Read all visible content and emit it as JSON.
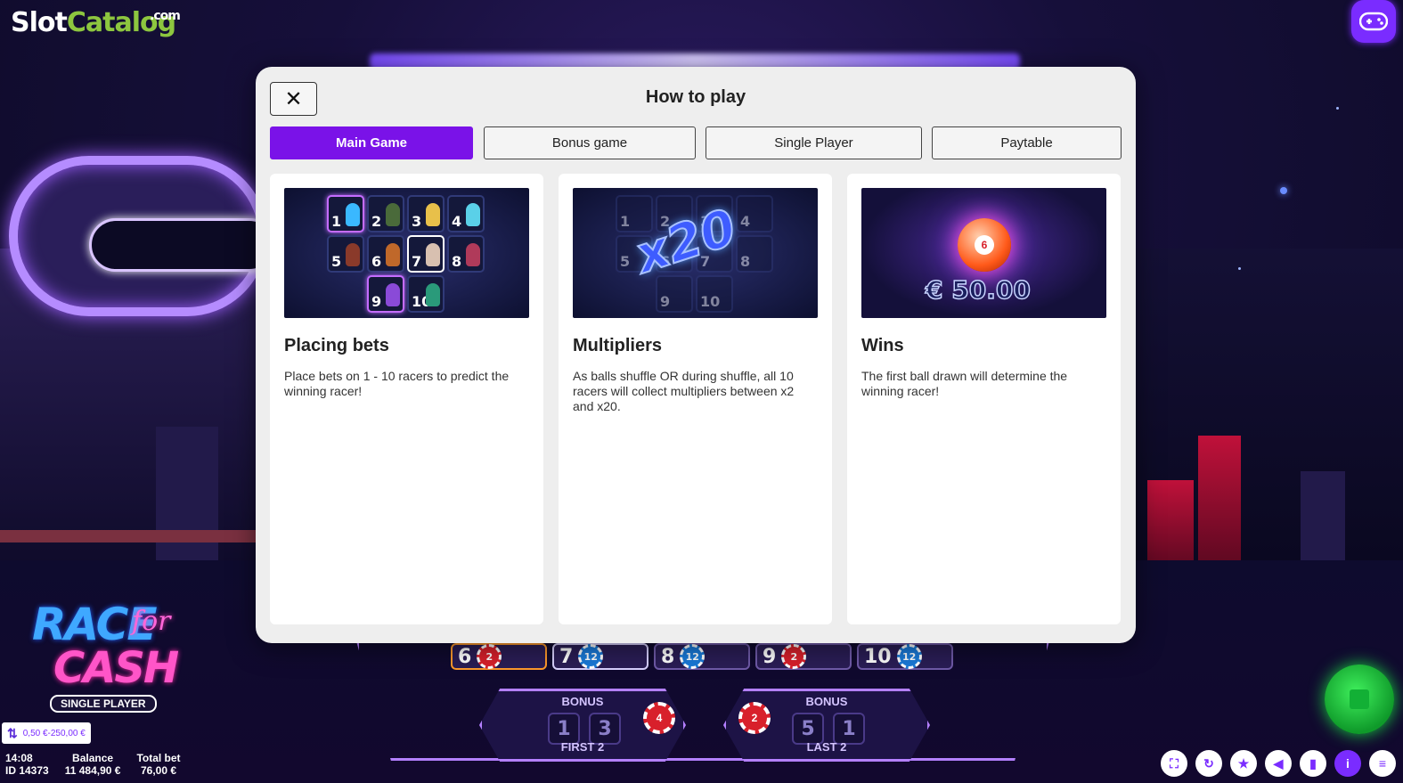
{
  "watermark": {
    "slot": "Slot",
    "catalog": "Catalog",
    "com": ".com"
  },
  "game_logo": {
    "race": "RACE",
    "for": "for",
    "cash": "CASH",
    "mode": "SINGLE PLAYER"
  },
  "modal": {
    "close_label": "✕",
    "title": "How to play",
    "tabs": [
      {
        "label": "Main Game",
        "active": true
      },
      {
        "label": "Bonus game",
        "active": false
      },
      {
        "label": "Single Player",
        "active": false
      },
      {
        "label": "Paytable",
        "active": false
      }
    ],
    "cards": [
      {
        "title": "Placing bets",
        "text": "Place bets on 1 - 10 racers to predict the winning racer!",
        "racers": [
          "1",
          "2",
          "3",
          "4",
          "5",
          "6",
          "7",
          "8",
          "9",
          "10"
        ]
      },
      {
        "title": "Multipliers",
        "text": "As balls shuffle OR during shuffle, all 10 racers will collect multipliers between x2 and x20.",
        "multiplier": "x20",
        "racers": [
          "1",
          "2",
          "3",
          "4",
          "5",
          "6",
          "7",
          "8",
          "9",
          "10"
        ]
      },
      {
        "title": "Wins",
        "text": "The first ball drawn will determine the winning racer!",
        "ball_number": "6",
        "amount": "€ 50.00"
      }
    ]
  },
  "racer_strip": [
    {
      "number": "6",
      "chip": "2",
      "chip_color": "red"
    },
    {
      "number": "7",
      "chip": "12",
      "chip_color": "blue"
    },
    {
      "number": "8",
      "chip": "12",
      "chip_color": "blue"
    },
    {
      "number": "9",
      "chip": "2",
      "chip_color": "red"
    },
    {
      "number": "10",
      "chip": "12",
      "chip_color": "blue"
    }
  ],
  "bonus": {
    "first": {
      "title": "BONUS",
      "sub": "FIRST 2",
      "numbers": [
        "1",
        "3"
      ],
      "chip": "4"
    },
    "last": {
      "title": "BONUS",
      "sub": "LAST 2",
      "numbers": [
        "5",
        "1"
      ],
      "chip": "2"
    }
  },
  "footer": {
    "bet_range": "0,50 €-250,00 €",
    "time": "14:08",
    "id": "ID 14373",
    "balance_label": "Balance",
    "balance": "11 484,90 €",
    "total_bet_label": "Total bet",
    "total_bet": "76,00 €"
  },
  "toolbar": {
    "icons": [
      "fullscreen-icon",
      "autoplay-icon",
      "favorite-icon",
      "sound-icon",
      "stats-icon",
      "info-icon",
      "menu-icon"
    ],
    "glyphs": [
      "⛶",
      "↻",
      "★",
      "◀",
      "▮",
      "i",
      "≡"
    ]
  },
  "colors": {
    "accent": "#7a12e8",
    "spin": "#18d040",
    "watermark_green": "#8dc63f"
  }
}
